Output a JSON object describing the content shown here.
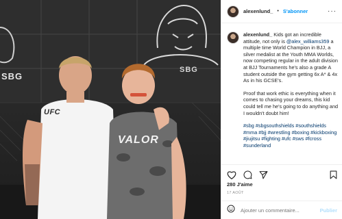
{
  "post": {
    "username": "alexenlund_",
    "separator": "•",
    "follow_label": "S'abonner",
    "more_label": "···",
    "caption": {
      "intro": "Kids got an incredible attitude, not only is ",
      "mention": "@alex_williams359",
      "body": " a multiple time World Champion in BJJ, a silver medalist at the Youth MMA Worlds, now competing regular in the adult division at BJJ Tournaments he's also a grade A student outside the gym getting 6x A* & 4x As in his GCSE's.",
      "para2": "Proof that work ethic is everything when it comes to chasing your dreams, this kid could tell me he's going to do anything and I wouldn't doubt him!",
      "hashtags": "#sbg #sbgsouthshields #southshields #mma #bjj #wrestling #boxing #kickboxing #jiujitsu #fighting #ufc #sws #fcross #sunderland"
    },
    "likes": "280 J'aime",
    "date": "17 AOÛT",
    "comment_placeholder": "Ajouter un commentaire...",
    "publish_label": "Publier"
  },
  "photo": {
    "shirt_logo_left": "UFC",
    "shirt_logo_right": "VALOR",
    "wall_logo_left": "SBG",
    "wall_logo_right": "SBG"
  },
  "icons": {
    "like": "heart-icon",
    "comment": "comment-icon",
    "share": "share-icon",
    "save": "bookmark-icon",
    "emoji": "emoji-icon",
    "more": "more-icon"
  },
  "colors": {
    "link": "#0095f6",
    "mention": "#00376b",
    "muted": "#8e8e8e"
  }
}
